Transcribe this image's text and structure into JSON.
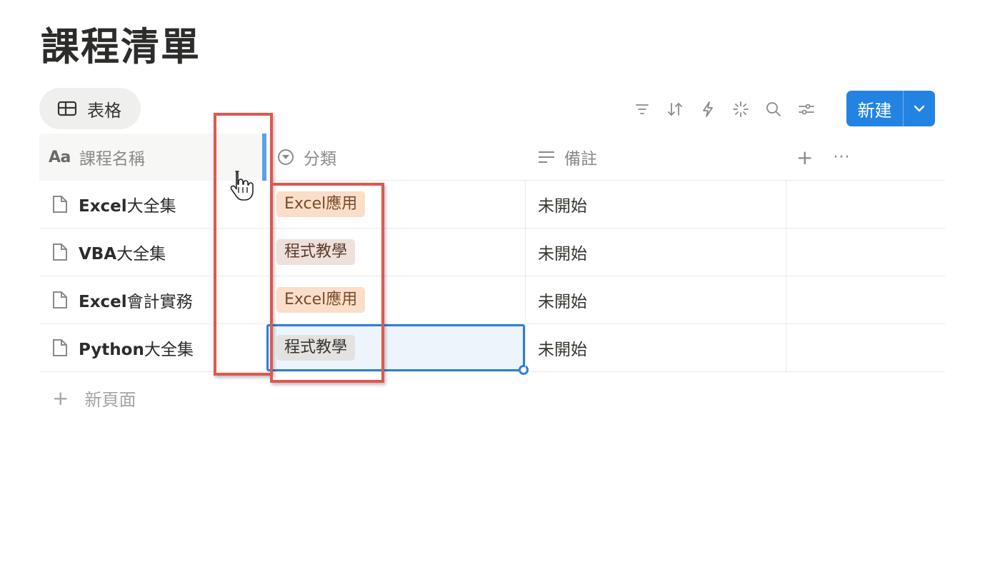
{
  "page": {
    "title": "課程清單"
  },
  "view": {
    "tab_label": "表格",
    "tab_icon": "table-icon"
  },
  "toolbar": {
    "icons": [
      "filter-icon",
      "sort-icon",
      "automation-icon",
      "ai-sparkle-icon",
      "search-icon",
      "settings-sliders-icon"
    ],
    "new_label": "新建",
    "new_dropdown_icon": "chevron-down-icon",
    "accent_color": "#2383e2"
  },
  "table": {
    "columns": {
      "name": {
        "prefix": "Aa",
        "label": "課程名稱"
      },
      "category": {
        "label": "分類",
        "icon": "select-icon"
      },
      "notes": {
        "label": "備註",
        "icon": "text-lines-icon"
      },
      "add_icon": "plus-icon",
      "more_icon": "more-horizontal-icon"
    },
    "rows": [
      {
        "name_bold": "Excel",
        "name_rest": "大全集",
        "category": "Excel應用",
        "category_color": "orange",
        "notes": "未開始"
      },
      {
        "name_bold": "VBA",
        "name_rest": "大全集",
        "category": "程式教學",
        "category_color": "brown",
        "notes": "未開始"
      },
      {
        "name_bold": "Excel",
        "name_rest": "會計實務",
        "category": "Excel應用",
        "category_color": "orange",
        "notes": "未開始"
      },
      {
        "name_bold": "Python",
        "name_rest": "大全集",
        "category": "程式教學",
        "category_color": "gray",
        "notes": "未開始"
      }
    ],
    "new_page_label": "新頁面"
  },
  "annotation": {
    "highlight_color": "#e0584f"
  }
}
